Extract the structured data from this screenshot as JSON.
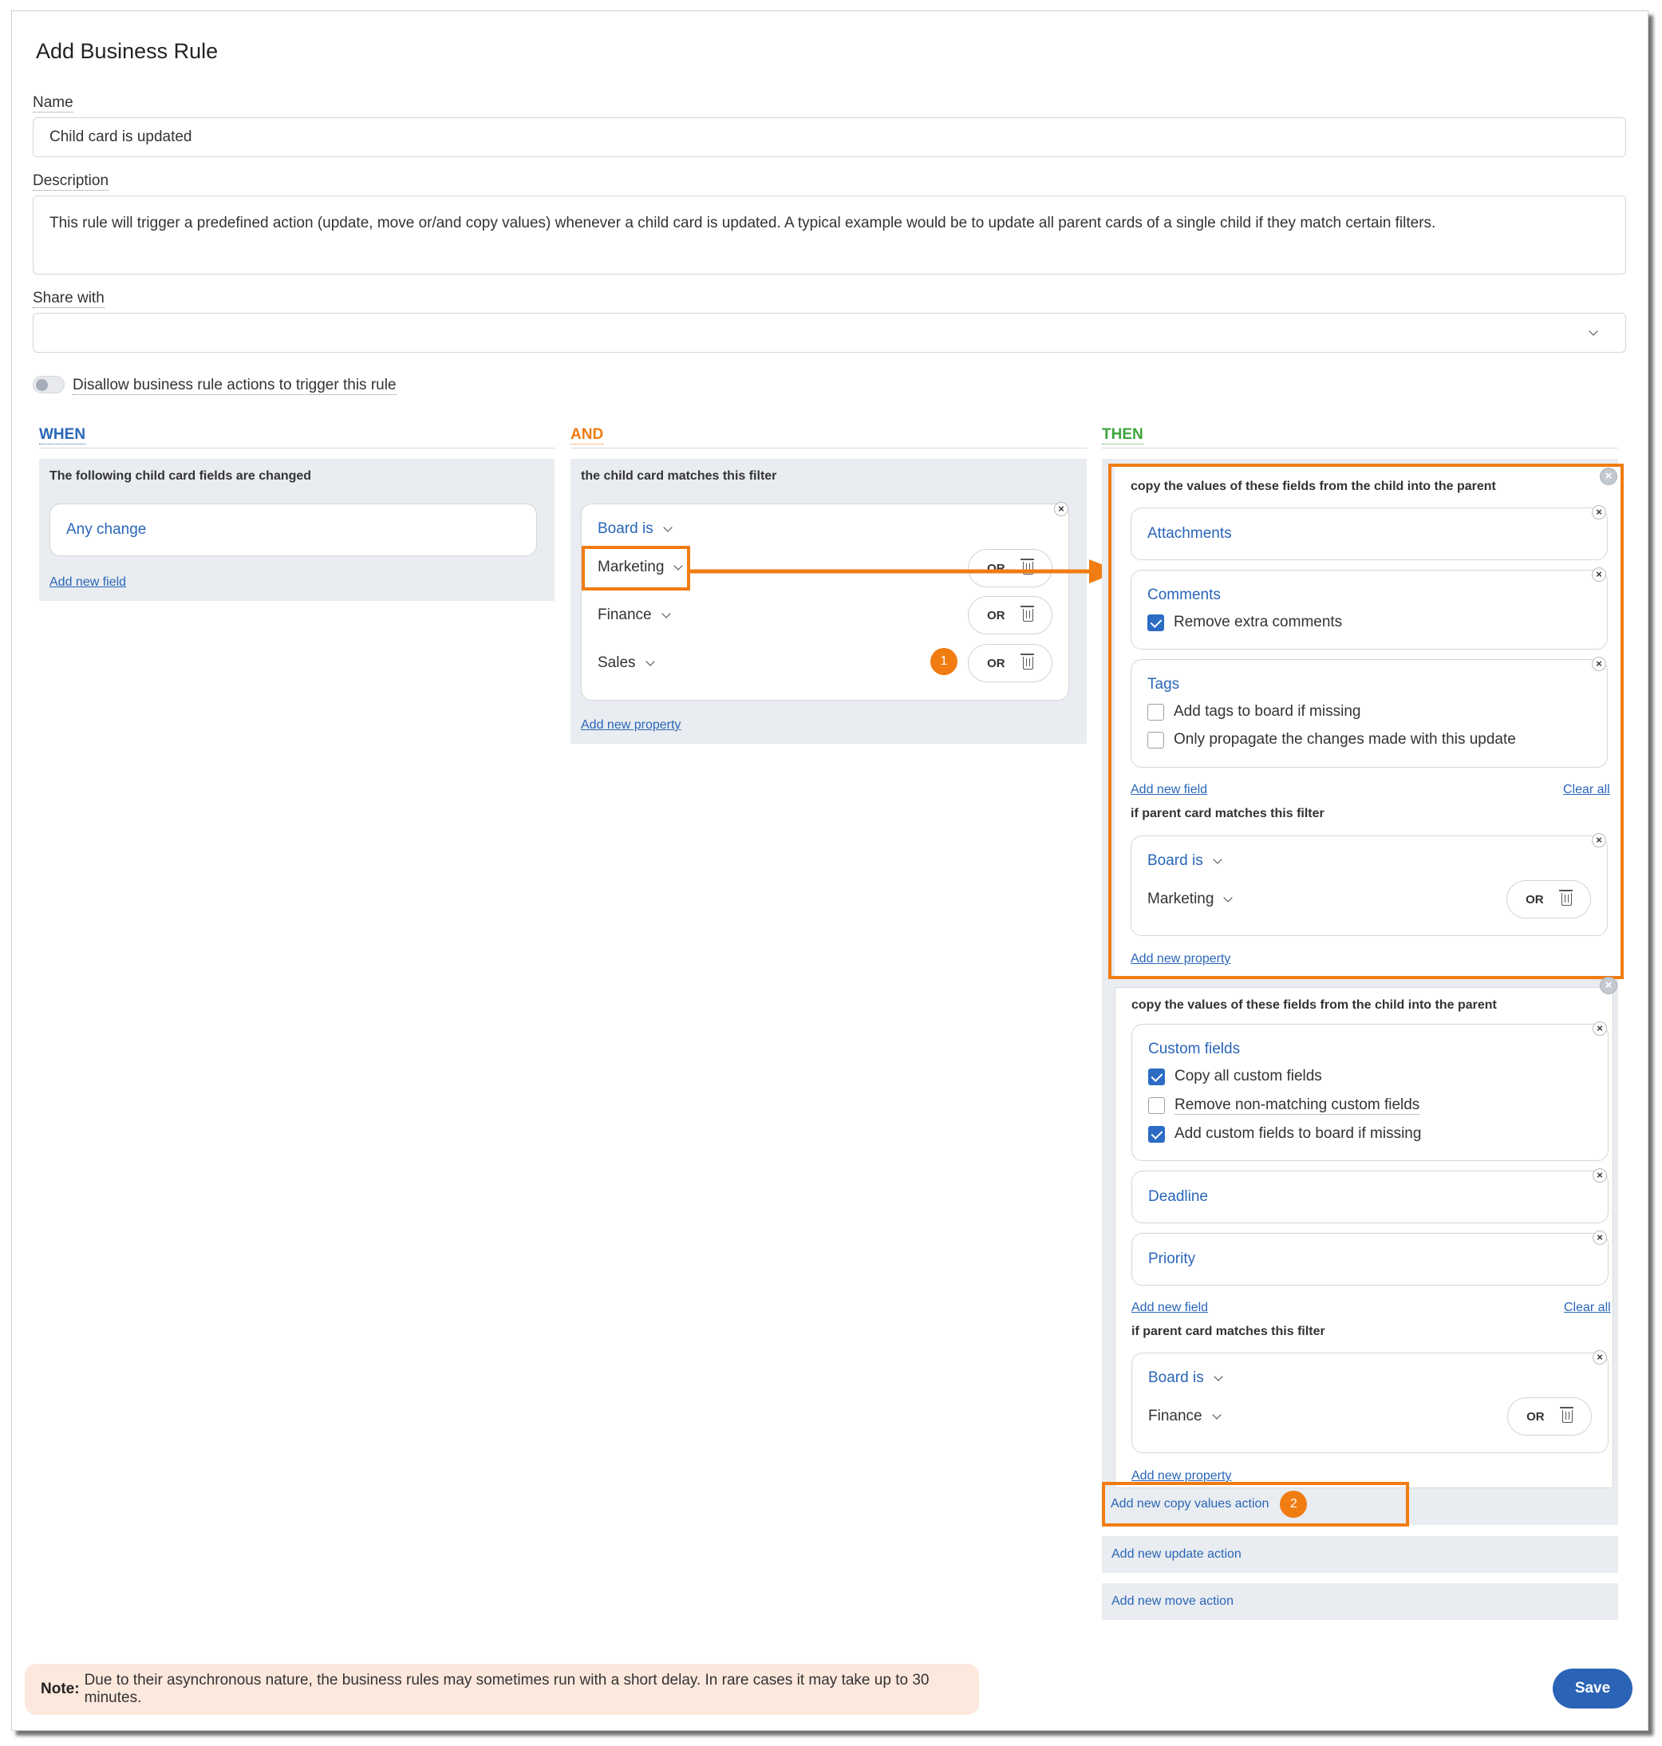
{
  "dialog": {
    "title": "Add Business Rule"
  },
  "form": {
    "name_label": "Name",
    "name_value": "Child card is updated",
    "description_label": "Description",
    "description_value": "This rule will trigger a predefined action (update, move or/and copy values) whenever a child card is updated. A typical example would be to update all parent cards of a single child if they match certain filters.",
    "share_label": "Share with",
    "share_value": "",
    "toggle_label": "Disallow business rule actions to trigger this rule",
    "toggle_on": false
  },
  "columns": {
    "when": {
      "heading": "WHEN",
      "color": "#2966b8"
    },
    "and": {
      "heading": "AND",
      "color": "#f07c12"
    },
    "then": {
      "heading": "THEN",
      "color": "#3ca53c"
    }
  },
  "when_panel": {
    "caption": "The following child card fields are changed",
    "field": "Any change",
    "add_link": "Add new field"
  },
  "and_panel": {
    "caption": "the child card matches this filter",
    "property": "Board is",
    "values": [
      "Marketing",
      "Finance",
      "Sales"
    ],
    "or_label": "OR",
    "badge": "1",
    "add_link": "Add new property"
  },
  "then_actions": [
    {
      "caption": "copy the values of these fields from the child into the parent",
      "fields": [
        {
          "name": "Attachments",
          "options": []
        },
        {
          "name": "Comments",
          "options": [
            {
              "label": "Remove extra comments",
              "checked": true
            }
          ]
        },
        {
          "name": "Tags",
          "options": [
            {
              "label": "Add tags to board if missing",
              "checked": false
            },
            {
              "label": "Only propagate the changes made with this update",
              "checked": false
            }
          ]
        }
      ],
      "add_field": "Add new field",
      "clear_all": "Clear all",
      "filter_caption": "if parent card matches this filter",
      "filter_property": "Board is",
      "filter_value": "Marketing",
      "or_label": "OR",
      "add_property": "Add new property"
    },
    {
      "caption": "copy the values of these fields from the child into the parent",
      "fields": [
        {
          "name": "Custom fields",
          "options": [
            {
              "label": "Copy all custom fields",
              "checked": true
            },
            {
              "label": "Remove non-matching custom fields",
              "checked": false
            },
            {
              "label": "Add custom fields to board if missing",
              "checked": true
            }
          ]
        },
        {
          "name": "Deadline",
          "options": []
        },
        {
          "name": "Priority",
          "options": []
        }
      ],
      "add_field": "Add new field",
      "clear_all": "Clear all",
      "filter_caption": "if parent card matches this filter",
      "filter_property": "Board is",
      "filter_value": "Finance",
      "or_label": "OR",
      "add_property": "Add new property"
    }
  ],
  "then_links": {
    "copy": "Add new copy values action",
    "copy_badge": "2",
    "update": "Add new update action",
    "move": "Add new move action"
  },
  "footer": {
    "note_bold": "Note:",
    "note_text": "Due to their asynchronous nature, the business rules may sometimes run with a short delay. In rare cases it may take up to 30 minutes.",
    "save": "Save"
  },
  "colors": {
    "accent": "#2b63b6",
    "highlight": "#f07c12",
    "link": "#2966b8"
  },
  "icons": [
    "chevron-down-icon",
    "close-icon",
    "trash-icon",
    "check-icon",
    "arrow-icon"
  ]
}
